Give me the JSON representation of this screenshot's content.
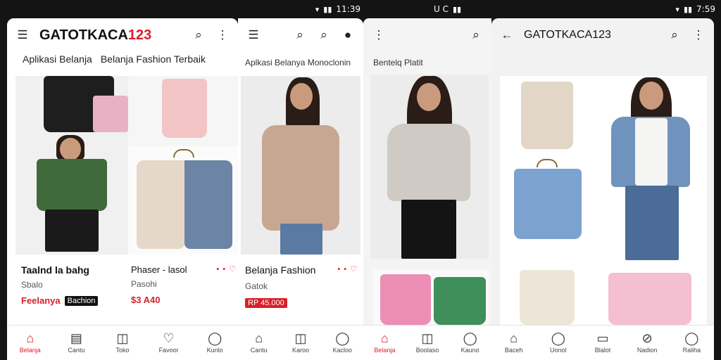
{
  "status": {
    "left_time": "11:39",
    "mid_label": "U C",
    "right_time": "7:59"
  },
  "phone1": {
    "title_prefix": "GATOTKACA",
    "title_suffix": "123",
    "subtitle_left": "Aplikasi Belanja",
    "subtitle_right": "Belanja Fashion Terbaik",
    "card1": {
      "name": "Taalnd la bahg",
      "sub": "Sbalo",
      "promo": "Feelanya",
      "badge": "Bachion",
      "price": "$3 A40"
    },
    "card2": {
      "name": "Phaser - lasol",
      "sub": "Pasohi"
    },
    "nav": [
      {
        "label": "Belanja",
        "icon": "home-icon",
        "glyph": "⌂"
      },
      {
        "label": "Cantu",
        "icon": "receipt-icon",
        "glyph": "▤"
      },
      {
        "label": "Toko",
        "icon": "bag-icon",
        "glyph": "◫"
      },
      {
        "label": "Favoor",
        "icon": "heart-icon",
        "glyph": "♡"
      },
      {
        "label": "Kunlo",
        "icon": "user-icon",
        "glyph": "◯"
      }
    ]
  },
  "phone2": {
    "subtitle": "Aplkasi Belanya Monoclonin",
    "card": {
      "name": "Belanja Fashion",
      "sub": "Gatok",
      "price": "RP 45.000"
    },
    "nav": [
      {
        "label": "Cantu",
        "icon": "store-icon",
        "glyph": "⌂"
      },
      {
        "label": "Karoo",
        "icon": "bag-icon",
        "glyph": "◫"
      },
      {
        "label": "Kacloo",
        "icon": "user-icon",
        "glyph": "◯"
      }
    ]
  },
  "phone3": {
    "subtitle": "Bentelq Platit",
    "nav": [
      {
        "label": "Belanja",
        "icon": "home-icon",
        "glyph": "⌂"
      },
      {
        "label": "Boolaso",
        "icon": "bag-icon",
        "glyph": "◫"
      },
      {
        "label": "Kauno",
        "icon": "user-icon",
        "glyph": "◯"
      }
    ]
  },
  "phone4": {
    "title": "GATOTKACA123",
    "nav": [
      {
        "label": "Baceh",
        "icon": "home-icon",
        "glyph": "⌂"
      },
      {
        "label": "Uonol",
        "icon": "user-icon",
        "glyph": "◯"
      },
      {
        "label": "Blalot",
        "icon": "calendar-icon",
        "glyph": "▭"
      },
      {
        "label": "Nadion",
        "icon": "compass-icon",
        "glyph": "⊘"
      },
      {
        "label": "Raliha",
        "icon": "profile-icon",
        "glyph": "◯"
      }
    ]
  }
}
